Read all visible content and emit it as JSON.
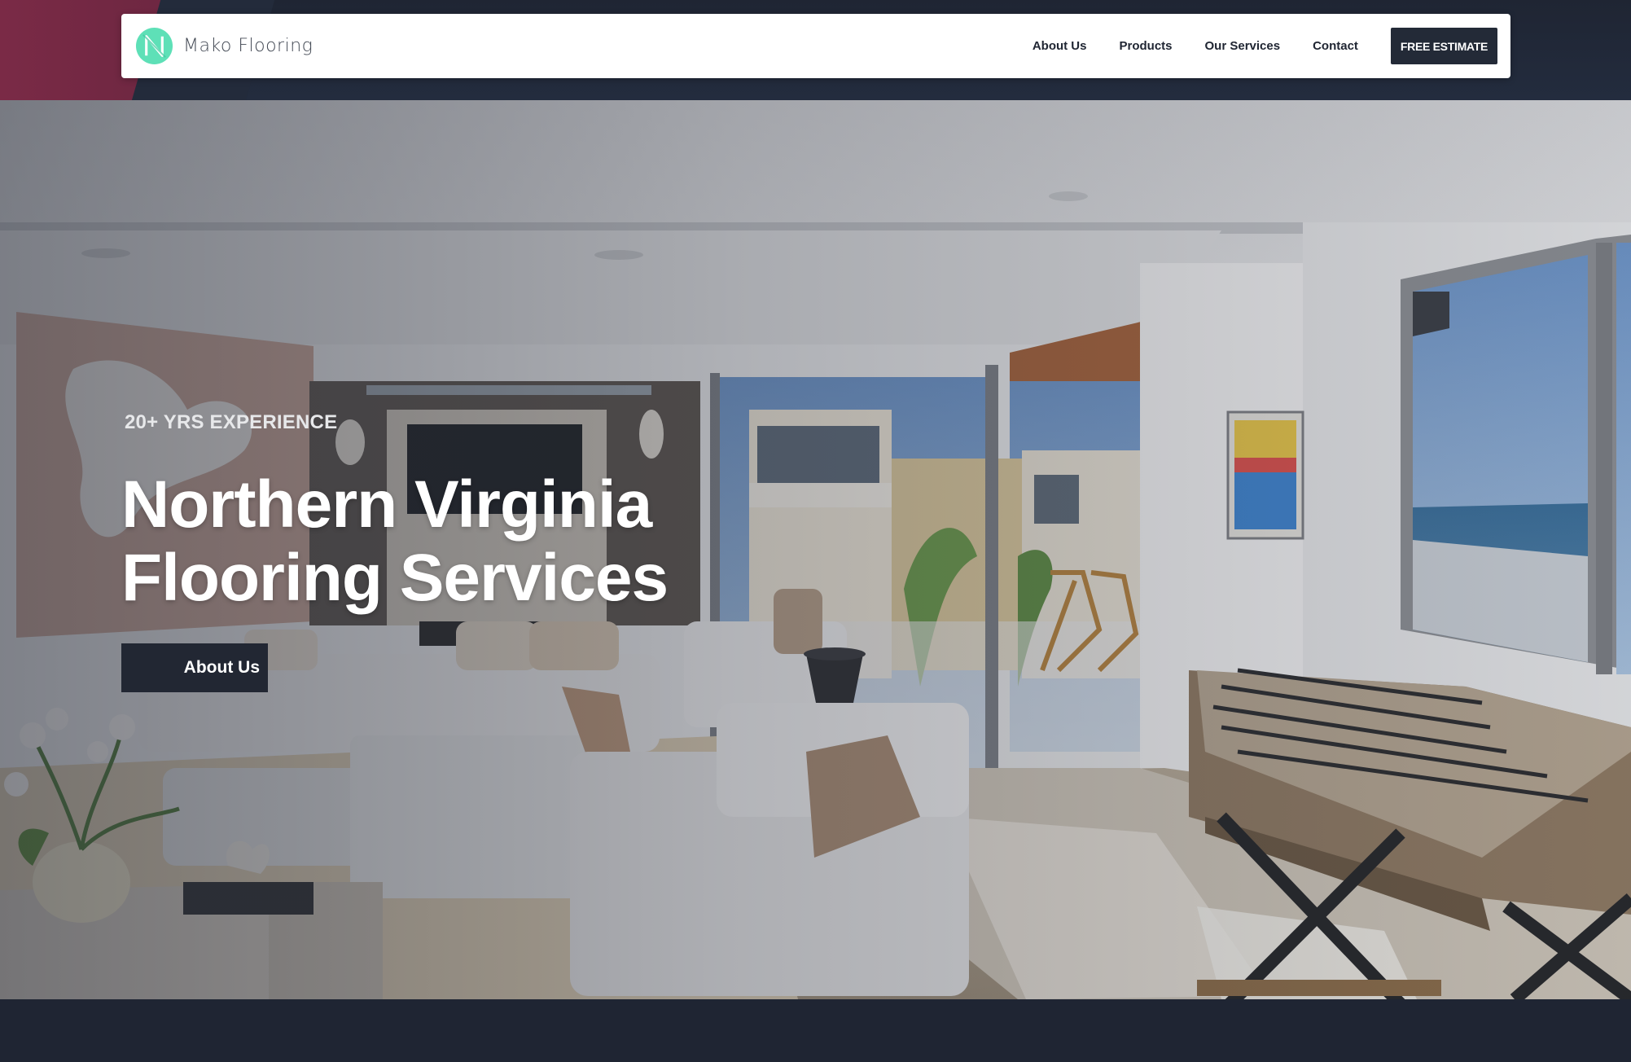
{
  "brand": {
    "name": "Mako Flooring",
    "logo_color": "#5ee0b7"
  },
  "nav": {
    "items": [
      {
        "label": "About Us"
      },
      {
        "label": "Products"
      },
      {
        "label": "Our Services"
      },
      {
        "label": "Contact"
      }
    ],
    "cta_label": "FREE ESTIMATE"
  },
  "hero": {
    "eyebrow": "20+ YRS EXPERIENCE",
    "title_line1": "Northern Virginia",
    "title_line2": "Flooring Services",
    "button_label": "About Us",
    "image_subject": "modern-living-room-photo"
  },
  "colors": {
    "dark_navy": "#1f2533",
    "accent_maroon": "#7a2a46",
    "button_dark": "#232a37",
    "white": "#ffffff"
  }
}
